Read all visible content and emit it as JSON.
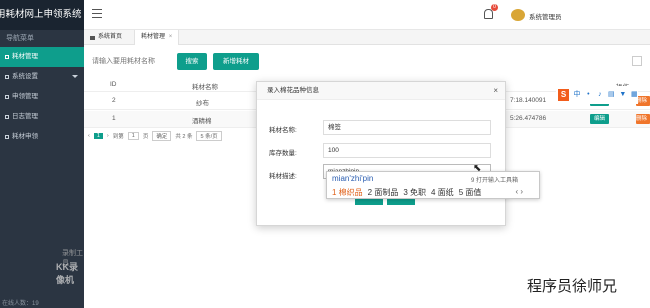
{
  "app": {
    "brand": "用耗材网上申领系统"
  },
  "sidebar": {
    "header": "导航菜单",
    "items": [
      {
        "label": "耗材管理",
        "active": true
      },
      {
        "label": "系统设置",
        "expandable": true
      },
      {
        "label": "申领管理"
      },
      {
        "label": "日志管理"
      },
      {
        "label": "耗材申领"
      }
    ],
    "online_text": "在线人数：19",
    "watermark_line1": "录制工具",
    "watermark_line2": "KK录像机"
  },
  "topbar": {
    "bell_badge": "0",
    "user": "系统管理员"
  },
  "tabs": {
    "home": "系统首页",
    "current": "耗材管理",
    "close": "×"
  },
  "search": {
    "placeholder": "请输入要用耗材名称",
    "search_button": "搜索",
    "add_button": "新增耗材"
  },
  "table": {
    "headers": {
      "id": "ID",
      "name": "耗材名称",
      "actions": "操作"
    },
    "rows": [
      {
        "id": "2",
        "name": "纱布",
        "time": "7:18.140091",
        "edit": "编辑",
        "delete": "删除"
      },
      {
        "id": "1",
        "name": "酒精棉",
        "time": "5:26.474786",
        "edit": "编辑",
        "delete": "删除"
      }
    ]
  },
  "pager": {
    "prev": "‹",
    "page": "1",
    "next": "›",
    "goto_label": "到第",
    "goto_value": "1",
    "page_unit": "页",
    "confirm": "确定",
    "total": "共 2 条",
    "per_page": "5 条/页"
  },
  "modal": {
    "title": "录入棉花品种信息",
    "close": "×",
    "fields": [
      {
        "label": "耗材名称:",
        "value": "棉签"
      },
      {
        "label": "库存数量:",
        "value": "100"
      },
      {
        "label": "耗材描述:",
        "value": "mianzhipin"
      }
    ]
  },
  "ime": {
    "pinyin": "mian'zhi'pin",
    "hint": "9 打开输入工具箱",
    "candidates": [
      "1 棉织品",
      "2 面制品",
      "3 免职",
      "4 面纸",
      "5 面值"
    ],
    "nav": "‹ ›"
  },
  "sogou": {
    "logo": "S",
    "lang": "中"
  },
  "signature": "程序员徐师兄",
  "colors": {
    "sidebar": "#2b3542",
    "accent": "#0e9e8c",
    "danger": "#f0752b"
  }
}
